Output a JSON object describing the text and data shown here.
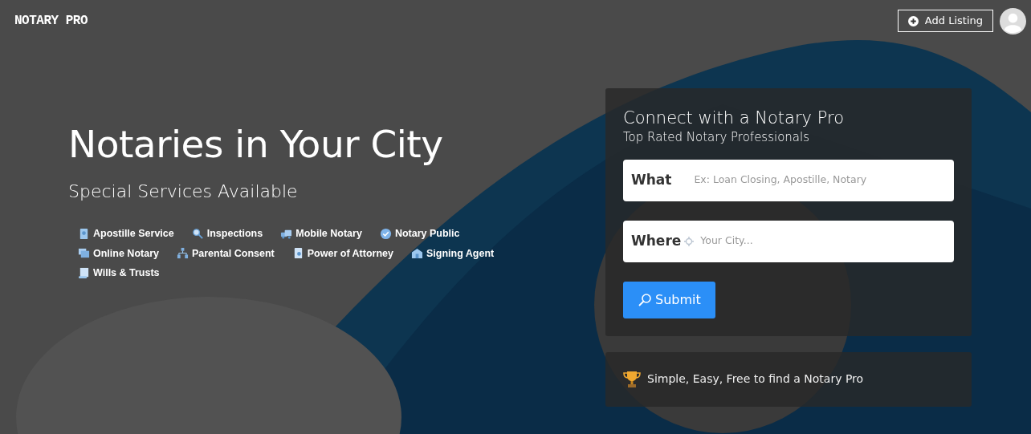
{
  "navbar": {
    "brand": "NOTARY PRO",
    "add_button": "Add Listing"
  },
  "hero": {
    "title": "Notaries in Your City",
    "subtitle": "Special Services Available",
    "services": [
      {
        "label": "Apostille Service"
      },
      {
        "label": "Inspections"
      },
      {
        "label": "Mobile Notary"
      },
      {
        "label": "Notary Public"
      },
      {
        "label": "Online Notary"
      },
      {
        "label": "Parental Consent"
      },
      {
        "label": "Power of Attorney"
      },
      {
        "label": "Signing Agent"
      },
      {
        "label": "Wills & Trusts"
      }
    ]
  },
  "search_card": {
    "title": "Connect with a Notary Pro",
    "subtitle": "Top Rated Notary Professionals",
    "fields": [
      {
        "label": "What",
        "placeholder": "Ex: Loan Closing, Apostille, Notary",
        "kind": "text"
      },
      {
        "label": "Where",
        "placeholder": "Your City...",
        "kind": "location"
      }
    ],
    "submit": "Submit"
  },
  "info_card": {
    "text": "Simple, Easy, Free to find a Notary Pro"
  }
}
